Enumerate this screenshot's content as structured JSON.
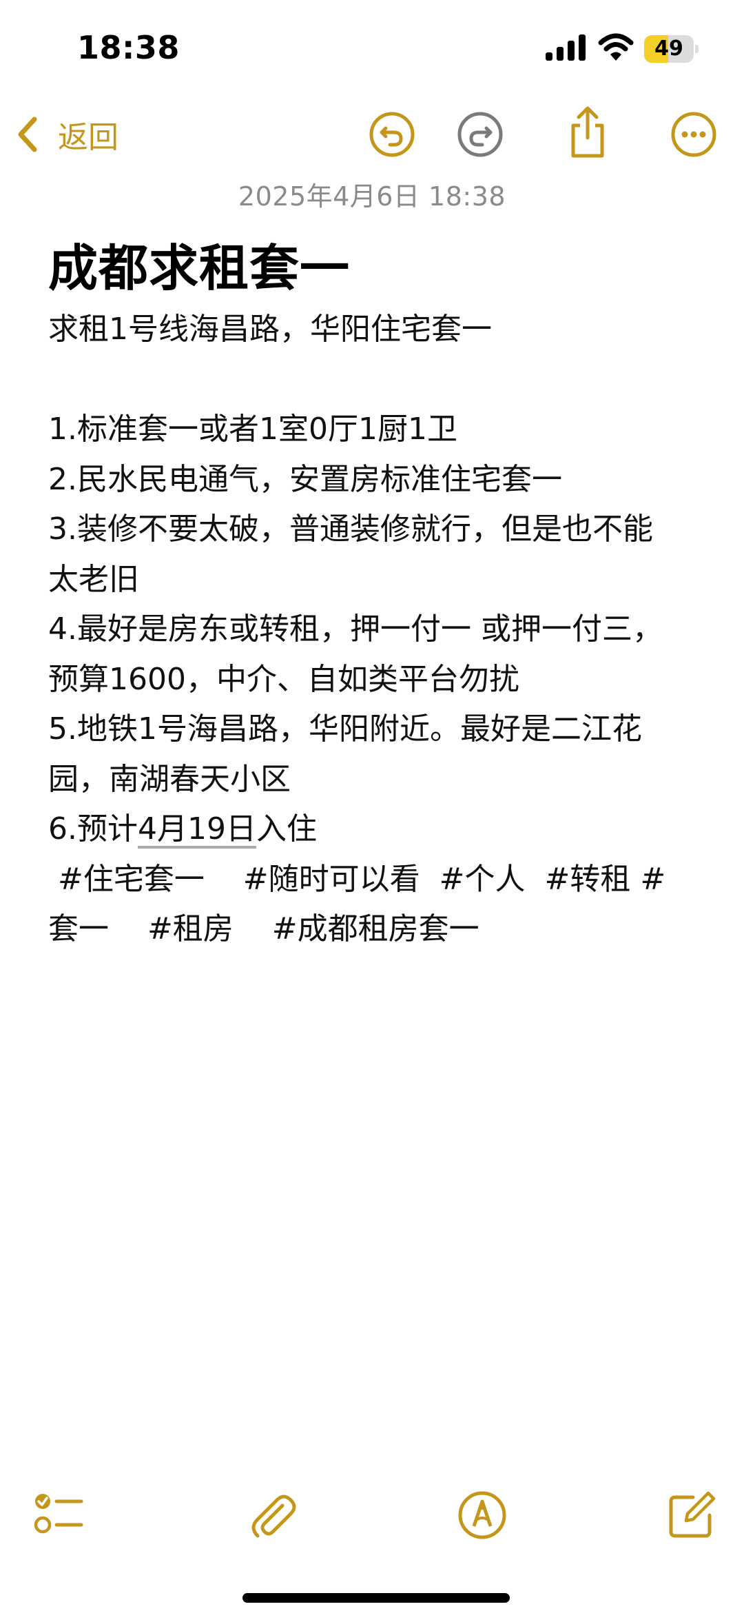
{
  "status_bar": {
    "time": "18:38",
    "battery_level": 49,
    "battery_text": "49",
    "icons": [
      "signal-icon",
      "wifi-icon",
      "battery-icon"
    ]
  },
  "toolbar": {
    "back_label": "返回",
    "icons": [
      "chevron-left-icon",
      "undo-icon",
      "redo-icon",
      "share-icon",
      "more-icon"
    ]
  },
  "note": {
    "date": "2025年4月6日 18:38",
    "title": "成都求租套一",
    "lines": {
      "l1": "求租1号线海昌路，华阳住宅套一",
      "l2": "",
      "l3": "1.标准套一或者1室0厅1厨1卫",
      "l4": "2.民水民电通气，安置房标准住宅套一",
      "l5": "3.装修不要太破，普通装修就行，但是也不能",
      "l6": "太老旧",
      "l7": "4.最好是房东或转租，押一付一 或押一付三，",
      "l8": "预算1600，中介、自如类平台勿扰",
      "l9": "5.地铁1号海昌路，华阳附近。最好是二江花",
      "l10": "园，南湖春天小区",
      "l11_prefix": "6.预计",
      "l11_date": "4月19日",
      "l11_suffix": "入住",
      "tags_line1": " #住宅套一    #随时可以看  #个人  #转租 #",
      "tags_line2": "套一    #租房    #成都租房套一"
    }
  },
  "bottom_toolbar": {
    "icons": [
      "checklist-icon",
      "paperclip-icon",
      "markup-pen-icon",
      "compose-icon"
    ]
  },
  "colors": {
    "accent": "#c4961a",
    "muted": "#8a8a8a",
    "battery": "#f4cf28"
  }
}
